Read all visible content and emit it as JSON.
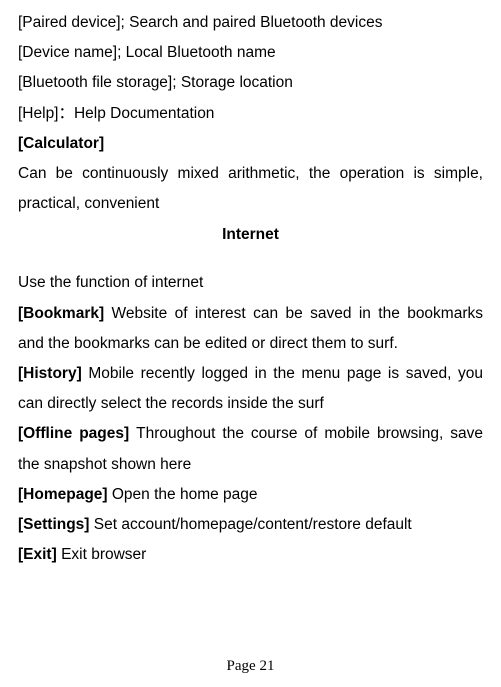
{
  "lines": {
    "l1": "[Paired device]; Search and paired Bluetooth devices",
    "l2": "[Device name]; Local Bluetooth name",
    "l3": "[Bluetooth file storage]; Storage location",
    "l4": "[Help]：Help Documentation",
    "l5": "[Calculator]",
    "l6": "Can be continuously mixed arithmetic, the operation is simple, practical, convenient",
    "heading": "Internet",
    "l7": "Use the function of internet",
    "l8_bold": "[Bookmark] ",
    "l8_rest": "Website of interest can be saved in the bookmarks and the bookmarks can be edited or direct them to surf.",
    "l9_bold": "[History] ",
    "l9_rest": "Mobile recently logged in the menu page is saved, you can directly select the records inside the surf",
    "l10_bold": "[Offline pages] ",
    "l10_rest": "Throughout the course of mobile browsing, save the snapshot shown here",
    "l11_bold": "[Homepage] ",
    "l11_rest": "Open the home page",
    "l12_bold": "[Settings] ",
    "l12_rest": "Set account/homepage/content/restore default",
    "l13_bold": "[Exit] ",
    "l13_rest": "Exit browser"
  },
  "page_number": "Page 21"
}
